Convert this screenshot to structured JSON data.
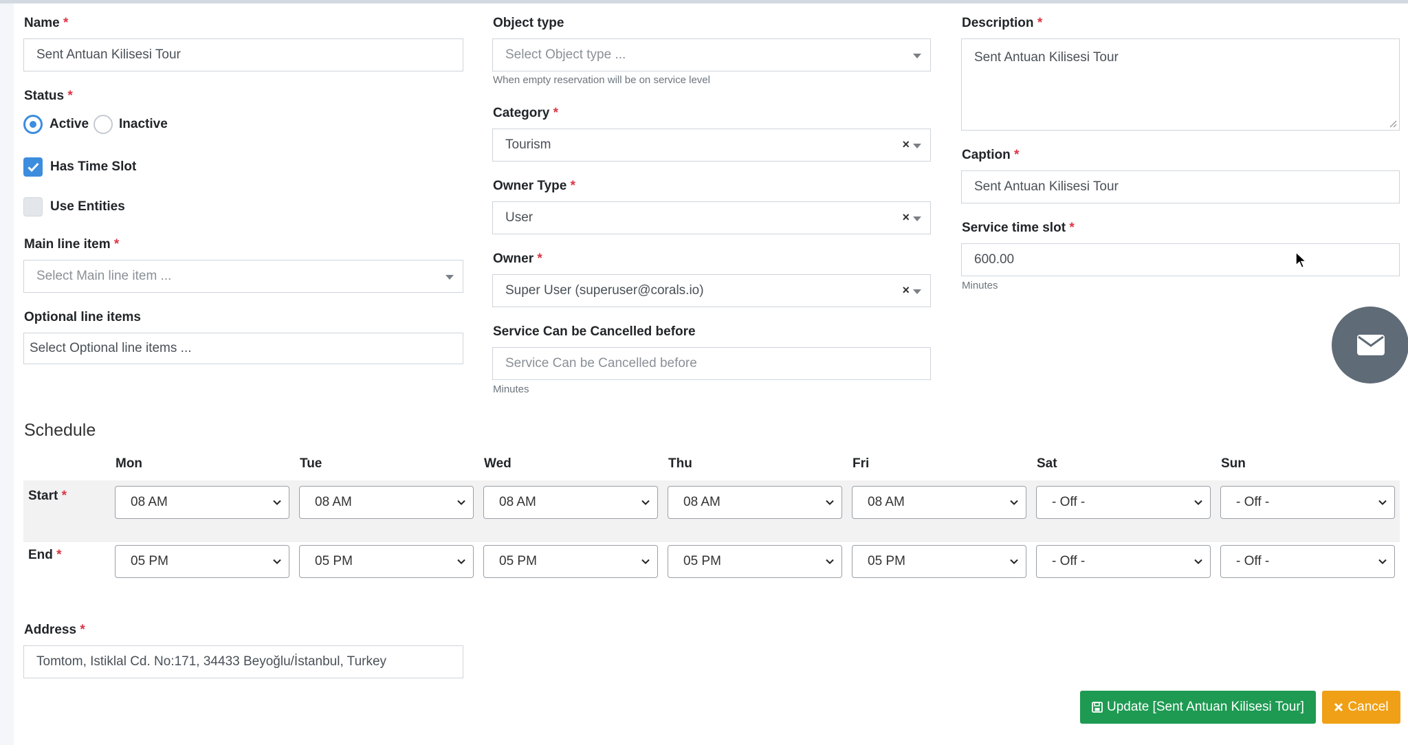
{
  "form": {
    "name": {
      "label": "Name",
      "value": "Sent Antuan Kilisesi Tour"
    },
    "status": {
      "label": "Status",
      "options": [
        "Active",
        "Inactive"
      ],
      "selected": "Active"
    },
    "has_time_slot": {
      "label": "Has Time Slot",
      "checked": true
    },
    "use_entities": {
      "label": "Use Entities",
      "checked": false
    },
    "main_line_item": {
      "label": "Main line item",
      "placeholder": "Select Main line item ..."
    },
    "optional_line_items": {
      "label": "Optional line items",
      "placeholder": "Select Optional line items ..."
    },
    "object_type": {
      "label": "Object type",
      "placeholder": "Select Object type ...",
      "help": "When empty reservation will be on service level"
    },
    "category": {
      "label": "Category",
      "value": "Tourism"
    },
    "owner_type": {
      "label": "Owner Type",
      "value": "User"
    },
    "owner": {
      "label": "Owner",
      "value": "Super User (superuser@corals.io)"
    },
    "cancel_before": {
      "label": "Service Can be Cancelled before",
      "placeholder": "Service Can be Cancelled before",
      "help": "Minutes"
    },
    "description": {
      "label": "Description",
      "value": "Sent Antuan Kilisesi Tour"
    },
    "caption": {
      "label": "Caption",
      "value": "Sent Antuan Kilisesi Tour"
    },
    "service_time_slot": {
      "label": "Service time slot",
      "value": "600.00",
      "help": "Minutes"
    },
    "address": {
      "label": "Address",
      "value": "Tomtom, Istiklal Cd. No:171, 34433 Beyoğlu/İstanbul, Turkey"
    },
    "required_mark": "*",
    "clear_mark": "×"
  },
  "schedule": {
    "title": "Schedule",
    "days": [
      "Mon",
      "Tue",
      "Wed",
      "Thu",
      "Fri",
      "Sat",
      "Sun"
    ],
    "start_label": "Start",
    "end_label": "End",
    "start": [
      "08 AM",
      "08 AM",
      "08 AM",
      "08 AM",
      "08 AM",
      "- Off -",
      "- Off -"
    ],
    "end": [
      "05 PM",
      "05 PM",
      "05 PM",
      "05 PM",
      "05 PM",
      "- Off -",
      "- Off -"
    ]
  },
  "actions": {
    "update_label": "Update [Sent Antuan Kilisesi Tour]",
    "cancel_label": "Cancel"
  },
  "colors": {
    "accent": "#3c8dde",
    "required": "#dc3545",
    "update": "#1e9a52",
    "cancel": "#f0a016",
    "fab": "#5f6b76"
  },
  "icons": {
    "fab": "envelope-icon",
    "update": "floppy-disk-icon",
    "cancel": "close-icon"
  }
}
